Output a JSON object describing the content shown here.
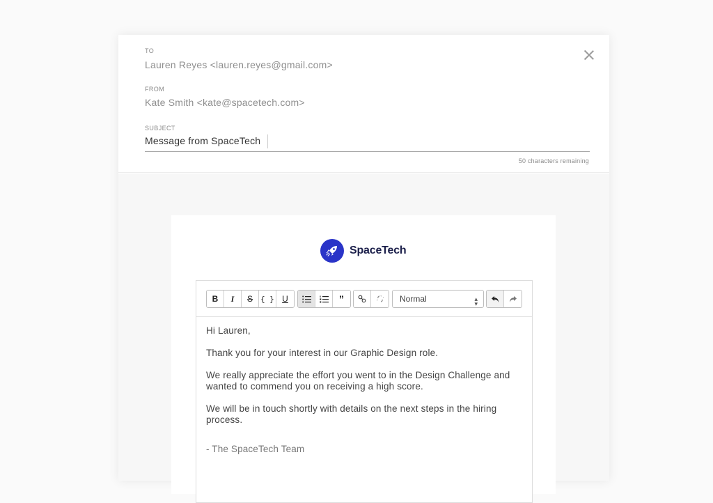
{
  "header": {
    "to_label": "TO",
    "to_value": "Lauren Reyes <lauren.reyes@gmail.com>",
    "from_label": "FROM",
    "from_value": "Kate Smith <kate@spacetech.com>",
    "subject_label": "SUBJECT",
    "subject_value": "Message from SpaceTech",
    "remaining_text": "50 characters remaining",
    "close_icon": "close-icon"
  },
  "logo": {
    "brand_name": "SpaceTech",
    "icon": "rocket-icon",
    "color": "#2a34c8"
  },
  "toolbar": {
    "format_buttons": [
      {
        "label": "B",
        "icon": "bold-icon"
      },
      {
        "label": "I",
        "icon": "italic-icon"
      },
      {
        "label": "S",
        "icon": "strikethrough-icon"
      },
      {
        "label": "{ }",
        "icon": "code-icon"
      },
      {
        "label": "U",
        "icon": "underline-icon"
      }
    ],
    "list_buttons": [
      {
        "icon": "bullet-list-icon",
        "active": true
      },
      {
        "icon": "numbered-list-icon",
        "active": false
      },
      {
        "icon": "blockquote-icon",
        "active": false
      }
    ],
    "link_buttons": [
      {
        "icon": "link-icon"
      },
      {
        "icon": "unlink-icon"
      }
    ],
    "block_style_selected": "Normal",
    "history_buttons": [
      {
        "icon": "undo-icon"
      },
      {
        "icon": "redo-icon"
      }
    ]
  },
  "message": {
    "greeting": "Hi Lauren,",
    "paragraphs": [
      "Thank you for your interest in our Graphic Design role.",
      "We really appreciate the effort you went to in the Design Challenge and wanted to commend you on receiving a high score.",
      "We will be in touch shortly with details on the next steps in the hiring process."
    ],
    "signature": "- The SpaceTech Team"
  }
}
